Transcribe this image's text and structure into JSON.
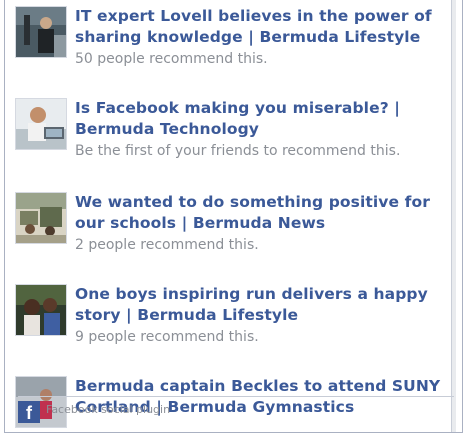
{
  "items": [
    {
      "title": "IT expert Lovell believes in the power of sharing knowledge | Bermuda Lifestyle",
      "meta": "50 people recommend this.",
      "thumb": "man-presenting-photo"
    },
    {
      "title": "Is Facebook making you miserable? | Bermuda Technology",
      "meta": "Be the first of your friends to recommend this.",
      "thumb": "woman-at-laptop-photo"
    },
    {
      "title": "We wanted to do something positive for our schools | Bermuda News",
      "meta": "2 people recommend this.",
      "thumb": "school-cleanup-photo"
    },
    {
      "title": "One boys inspiring run delivers a happy story | Bermuda Lifestyle",
      "meta": "9 people recommend this.",
      "thumb": "boys-smiling-photo"
    },
    {
      "title": "Bermuda captain Beckles to attend SUNY Cortland | Bermuda Gymnastics",
      "meta": "",
      "thumb": "gymnast-photo"
    }
  ],
  "footer": {
    "plugin_text": "Facebook social plugin",
    "logo": "f"
  }
}
